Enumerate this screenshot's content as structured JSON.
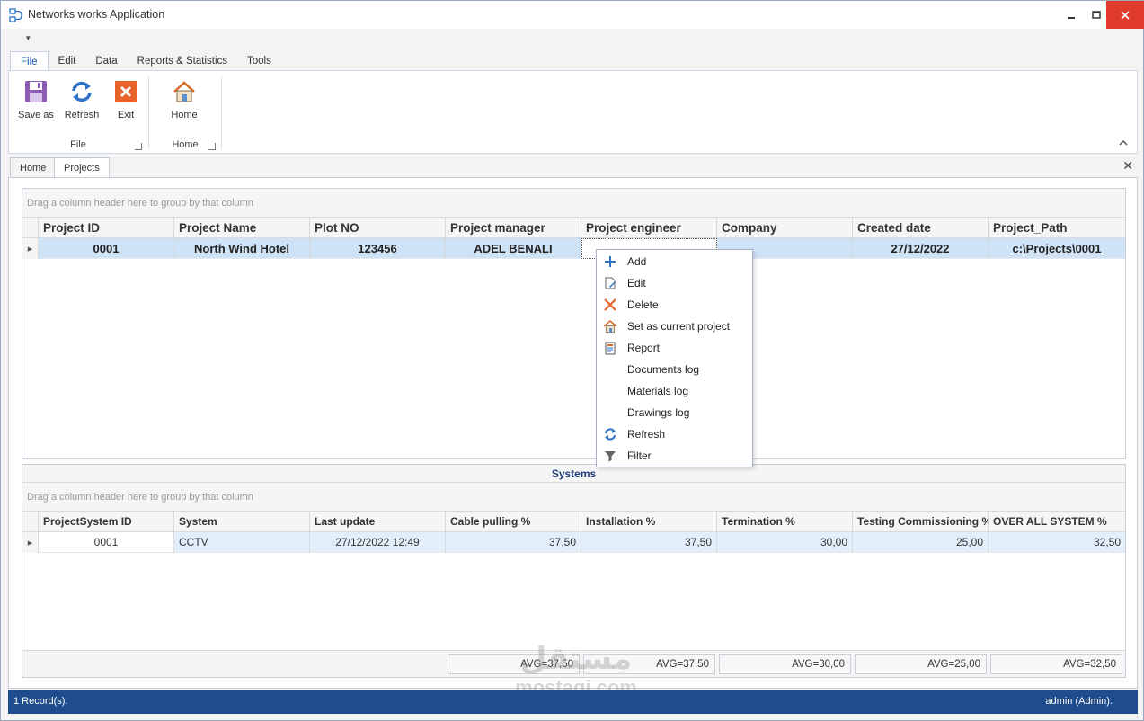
{
  "window": {
    "title": "Networks works Application"
  },
  "ribbon": {
    "qat_arrow": "▾",
    "tabs": [
      "File",
      "Edit",
      "Data",
      "Reports & Statistics",
      "Tools"
    ],
    "active_tab": "File",
    "groups": [
      {
        "label": "File",
        "buttons": [
          {
            "label": "Save as",
            "icon": "save-icon"
          },
          {
            "label": "Refresh",
            "icon": "refresh-icon"
          },
          {
            "label": "Exit",
            "icon": "exit-icon"
          }
        ]
      },
      {
        "label": "Home",
        "buttons": [
          {
            "label": "Home",
            "icon": "home-icon"
          }
        ]
      }
    ]
  },
  "doc_tabs": [
    "Home",
    "Projects"
  ],
  "projects_grid": {
    "group_hint": "Drag a column header here to group by that column",
    "columns": [
      "Project ID",
      "Project Name",
      "Plot NO",
      "Project manager",
      "Project engineer",
      "Company",
      "Created date",
      "Project_Path"
    ],
    "rows": [
      [
        "0001",
        "North Wind Hotel",
        "123456",
        "ADEL BENALI",
        "",
        "",
        "27/12/2022",
        "c:\\Projects\\0001"
      ]
    ]
  },
  "context_menu": {
    "items": [
      {
        "label": "Add",
        "icon": "plus-icon"
      },
      {
        "label": "Edit",
        "icon": "edit-icon"
      },
      {
        "label": "Delete",
        "icon": "delete-icon"
      },
      {
        "label": "Set as current project",
        "icon": "home-icon"
      },
      {
        "label": "Report",
        "icon": "report-icon"
      },
      {
        "label": "Documents log",
        "icon": ""
      },
      {
        "label": "Materials log",
        "icon": ""
      },
      {
        "label": "Drawings log",
        "icon": ""
      },
      {
        "label": "Refresh",
        "icon": "refresh-icon"
      },
      {
        "label": "Filter",
        "icon": "filter-icon"
      }
    ]
  },
  "systems_grid": {
    "caption": "Systems",
    "group_hint": "Drag a column header here to group by that column",
    "columns": [
      "ProjectSystem ID",
      "System",
      "Last update",
      "Cable pulling %",
      "Installation %",
      "Termination %",
      "Testing Commissioning  %",
      "OVER ALL SYSTEM %"
    ],
    "rows": [
      [
        "0001",
        "CCTV",
        "27/12/2022 12:49",
        "37,50",
        "37,50",
        "30,00",
        "25,00",
        "32,50"
      ]
    ],
    "footer": [
      "AVG=37,50",
      "AVG=37,50",
      "AVG=30,00",
      "AVG=25,00",
      "AVG=32,50"
    ]
  },
  "status": {
    "left": "1 Record(s).",
    "right": "admin (Admin)."
  },
  "watermark": {
    "arabic": "مستقل",
    "latin": "mostaqi.com"
  },
  "colors": {
    "accent": "#1f4c8c",
    "selection": "#cfe3f7",
    "close_button": "#e03b2d"
  }
}
